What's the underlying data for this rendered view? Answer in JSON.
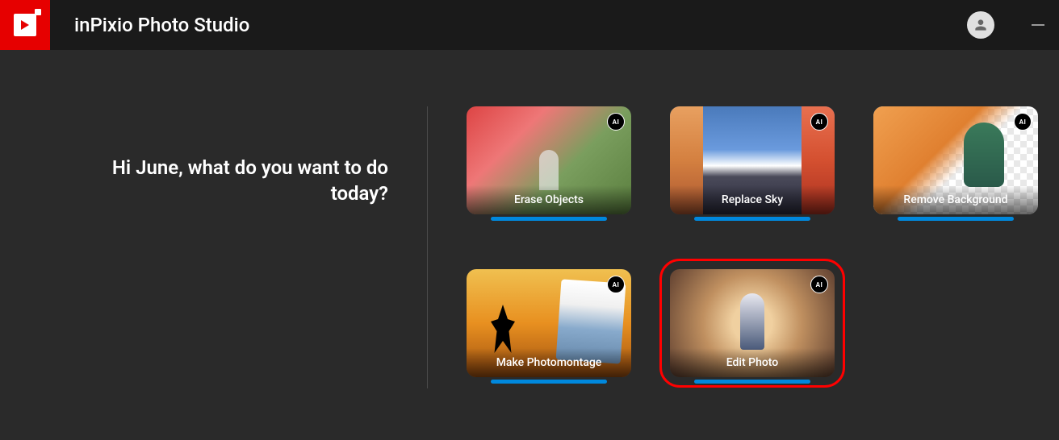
{
  "header": {
    "title": "inPixio Photo Studio"
  },
  "greeting": "Hi June, what do you want to do today?",
  "ai_badge": "AI",
  "cards": [
    {
      "label": "Erase Objects"
    },
    {
      "label": "Replace Sky"
    },
    {
      "label": "Remove Background"
    },
    {
      "label": "Make Photomontage"
    },
    {
      "label": "Edit Photo"
    }
  ]
}
